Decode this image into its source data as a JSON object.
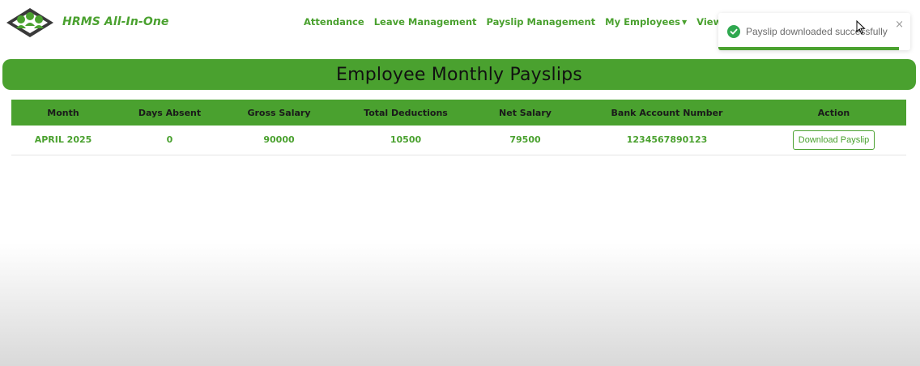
{
  "navbar": {
    "brand": "HRMS All-In-One",
    "links": [
      "Attendance",
      "Leave Management",
      "Payslip Management",
      "My Employees",
      "View Compa"
    ],
    "dropdown_caret_icon": "caret-down-icon"
  },
  "page": {
    "title": "Employee Monthly Payslips"
  },
  "table": {
    "columns": [
      "Month",
      "Days Absent",
      "Gross Salary",
      "Total Deductions",
      "Net Salary",
      "Bank Account Number",
      "Action"
    ],
    "rows": [
      {
        "month": "APRIL 2025",
        "days_absent": "0",
        "gross_salary": "90000",
        "total_deductions": "10500",
        "net_salary": "79500",
        "bank_account": "1234567890123",
        "action_label": "Download Payslip"
      }
    ]
  },
  "toast": {
    "message": "Payslip downloaded successfully",
    "close": "×",
    "icon": "check-circle-icon",
    "progress": 0.94
  },
  "colors": {
    "accent": "#4aa12f",
    "toast_success": "#2fa84f"
  }
}
